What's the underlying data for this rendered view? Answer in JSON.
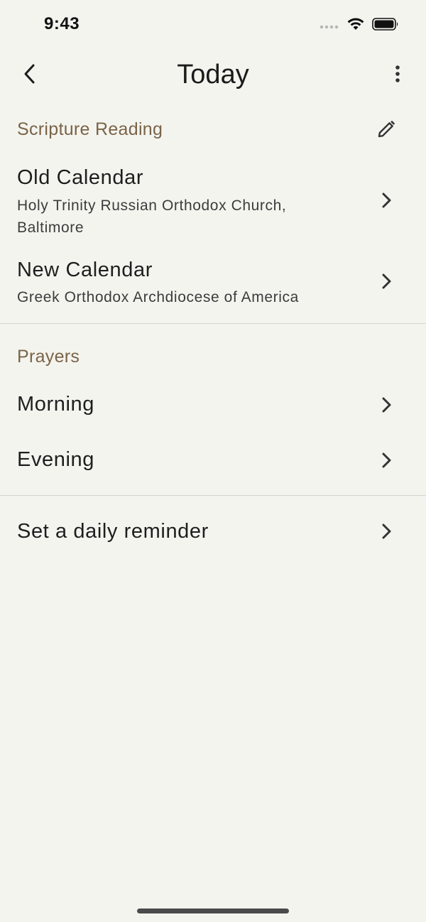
{
  "status_bar": {
    "time": "9:43",
    "icons": [
      "signal-dots-icon",
      "wifi-icon",
      "battery-icon"
    ]
  },
  "app_bar": {
    "title": "Today",
    "back_icon": "chevron-left-icon",
    "more_icon": "more-vertical-icon"
  },
  "scripture": {
    "header": "Scripture Reading",
    "edit_icon": "pencil-icon",
    "items": [
      {
        "title": "Old Calendar",
        "subtitle": "Holy Trinity Russian Orthodox Church, Baltimore"
      },
      {
        "title": "New Calendar",
        "subtitle": "Greek Orthodox Archdiocese of America"
      }
    ]
  },
  "prayers": {
    "header": "Prayers",
    "items": [
      {
        "title": "Morning"
      },
      {
        "title": "Evening"
      }
    ]
  },
  "reminder": {
    "title": "Set a daily reminder"
  },
  "colors": {
    "background": "#f4f4ef",
    "section_header": "#7a6447",
    "divider": "#d6d4cc",
    "text": "#1e1e1e"
  }
}
